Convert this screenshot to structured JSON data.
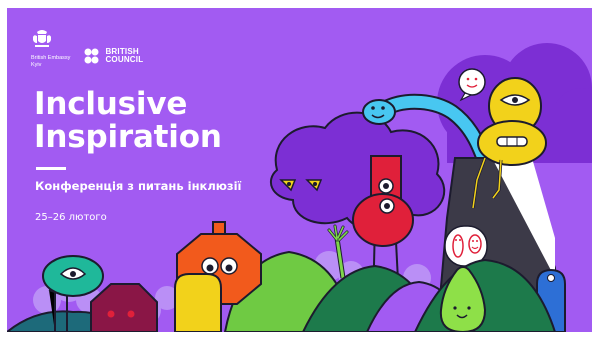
{
  "banner": {
    "background_color": "#a25bf2",
    "title_line1": "Inclusive",
    "title_line2": "Inspiration",
    "subtitle": "Конференція з питань інклюзії",
    "dates": "25–26 лютого"
  },
  "logos": {
    "embassy_line1": "British Embassy",
    "embassy_line2": "Kyiv",
    "council_line1": "BRITISH",
    "council_line2": "COUNCIL"
  },
  "icons": [
    "royal-crest-icon",
    "british-council-dots-icon"
  ]
}
